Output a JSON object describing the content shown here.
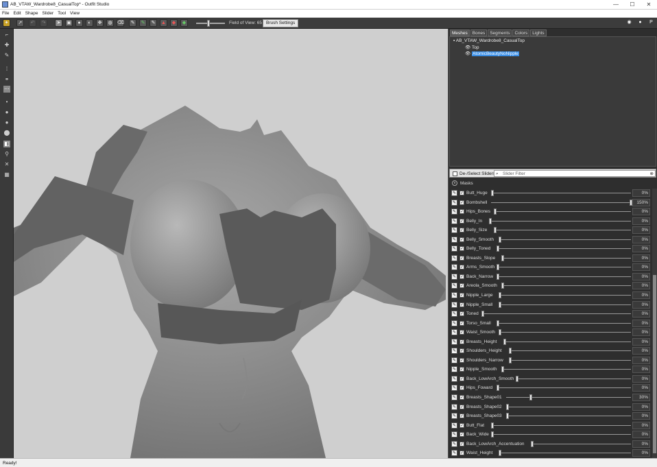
{
  "window": {
    "title": "AB_VTAW_Wardrobe8_CasualTop* - Outfit Studio"
  },
  "menu": [
    "File",
    "Edit",
    "Shape",
    "Slider",
    "Tool",
    "View"
  ],
  "toolbar": {
    "fov_label": "Field of View: 65",
    "brush_settings": "Brush Settings"
  },
  "tabs": [
    "Meshes",
    "Bones",
    "Segments",
    "Colors",
    "Lights"
  ],
  "meshes": {
    "root": "AB_VTAW_Wardrobe8_CasualTop",
    "items": [
      "Top",
      "AtomicBeautyNoNipple"
    ]
  },
  "sliders_header": {
    "deselect_label": "De-/Select Sliders",
    "filter_placeholder": "Slider Filter",
    "masks_label": "Masks"
  },
  "sliders": [
    {
      "name": "Butt_Huge",
      "value": 0,
      "display": "0%"
    },
    {
      "name": "Bombshell",
      "value": 150,
      "display": "150%"
    },
    {
      "name": "Hips_Bones",
      "value": 0,
      "display": "0%"
    },
    {
      "name": "Belly_In",
      "value": 0,
      "display": "0%"
    },
    {
      "name": "Belly_Size",
      "value": 0,
      "display": "0%"
    },
    {
      "name": "Belly_Smooth",
      "value": 0,
      "display": "0%"
    },
    {
      "name": "Belly_Toned",
      "value": 0,
      "display": "0%"
    },
    {
      "name": "Breasts_Slope",
      "value": 0,
      "display": "0%"
    },
    {
      "name": "Arms_Smooth",
      "value": 0,
      "display": "0%"
    },
    {
      "name": "Back_Narrow",
      "value": 0,
      "display": "0%"
    },
    {
      "name": "Areola_Smooth",
      "value": 0,
      "display": "0%"
    },
    {
      "name": "Nipple_Large",
      "value": 0,
      "display": "0%"
    },
    {
      "name": "Nipple_Small",
      "value": 0,
      "display": "0%"
    },
    {
      "name": "Toned",
      "value": 0,
      "display": "0%"
    },
    {
      "name": "Torso_Small",
      "value": 0,
      "display": "0%"
    },
    {
      "name": "Waist_Smooth",
      "value": 0,
      "display": "0%"
    },
    {
      "name": "Breasts_Height",
      "value": 0,
      "display": "0%"
    },
    {
      "name": "Shoulders_Height",
      "value": 0,
      "display": "0%"
    },
    {
      "name": "Shoulders_Narrow",
      "value": 0,
      "display": "0%"
    },
    {
      "name": "Nipple_Smooth",
      "value": 0,
      "display": "0%"
    },
    {
      "name": "Back_LowArch_Smooth",
      "value": 0,
      "display": "0%"
    },
    {
      "name": "Hips_Foward",
      "value": 0,
      "display": "0%"
    },
    {
      "name": "Breasts_Shape01",
      "value": 30,
      "display": "30%"
    },
    {
      "name": "Breasts_Shape02",
      "value": 0,
      "display": "0%"
    },
    {
      "name": "Breasts_Shape03",
      "value": 0,
      "display": "0%"
    },
    {
      "name": "Butt_Flat",
      "value": 0,
      "display": "0%"
    },
    {
      "name": "Back_Wide",
      "value": 0,
      "display": "0%"
    },
    {
      "name": "Back_LowArch_Accentuation",
      "value": 0,
      "display": "0%"
    },
    {
      "name": "Waist_Height",
      "value": 0,
      "display": "0%"
    }
  ],
  "status": "Ready!"
}
